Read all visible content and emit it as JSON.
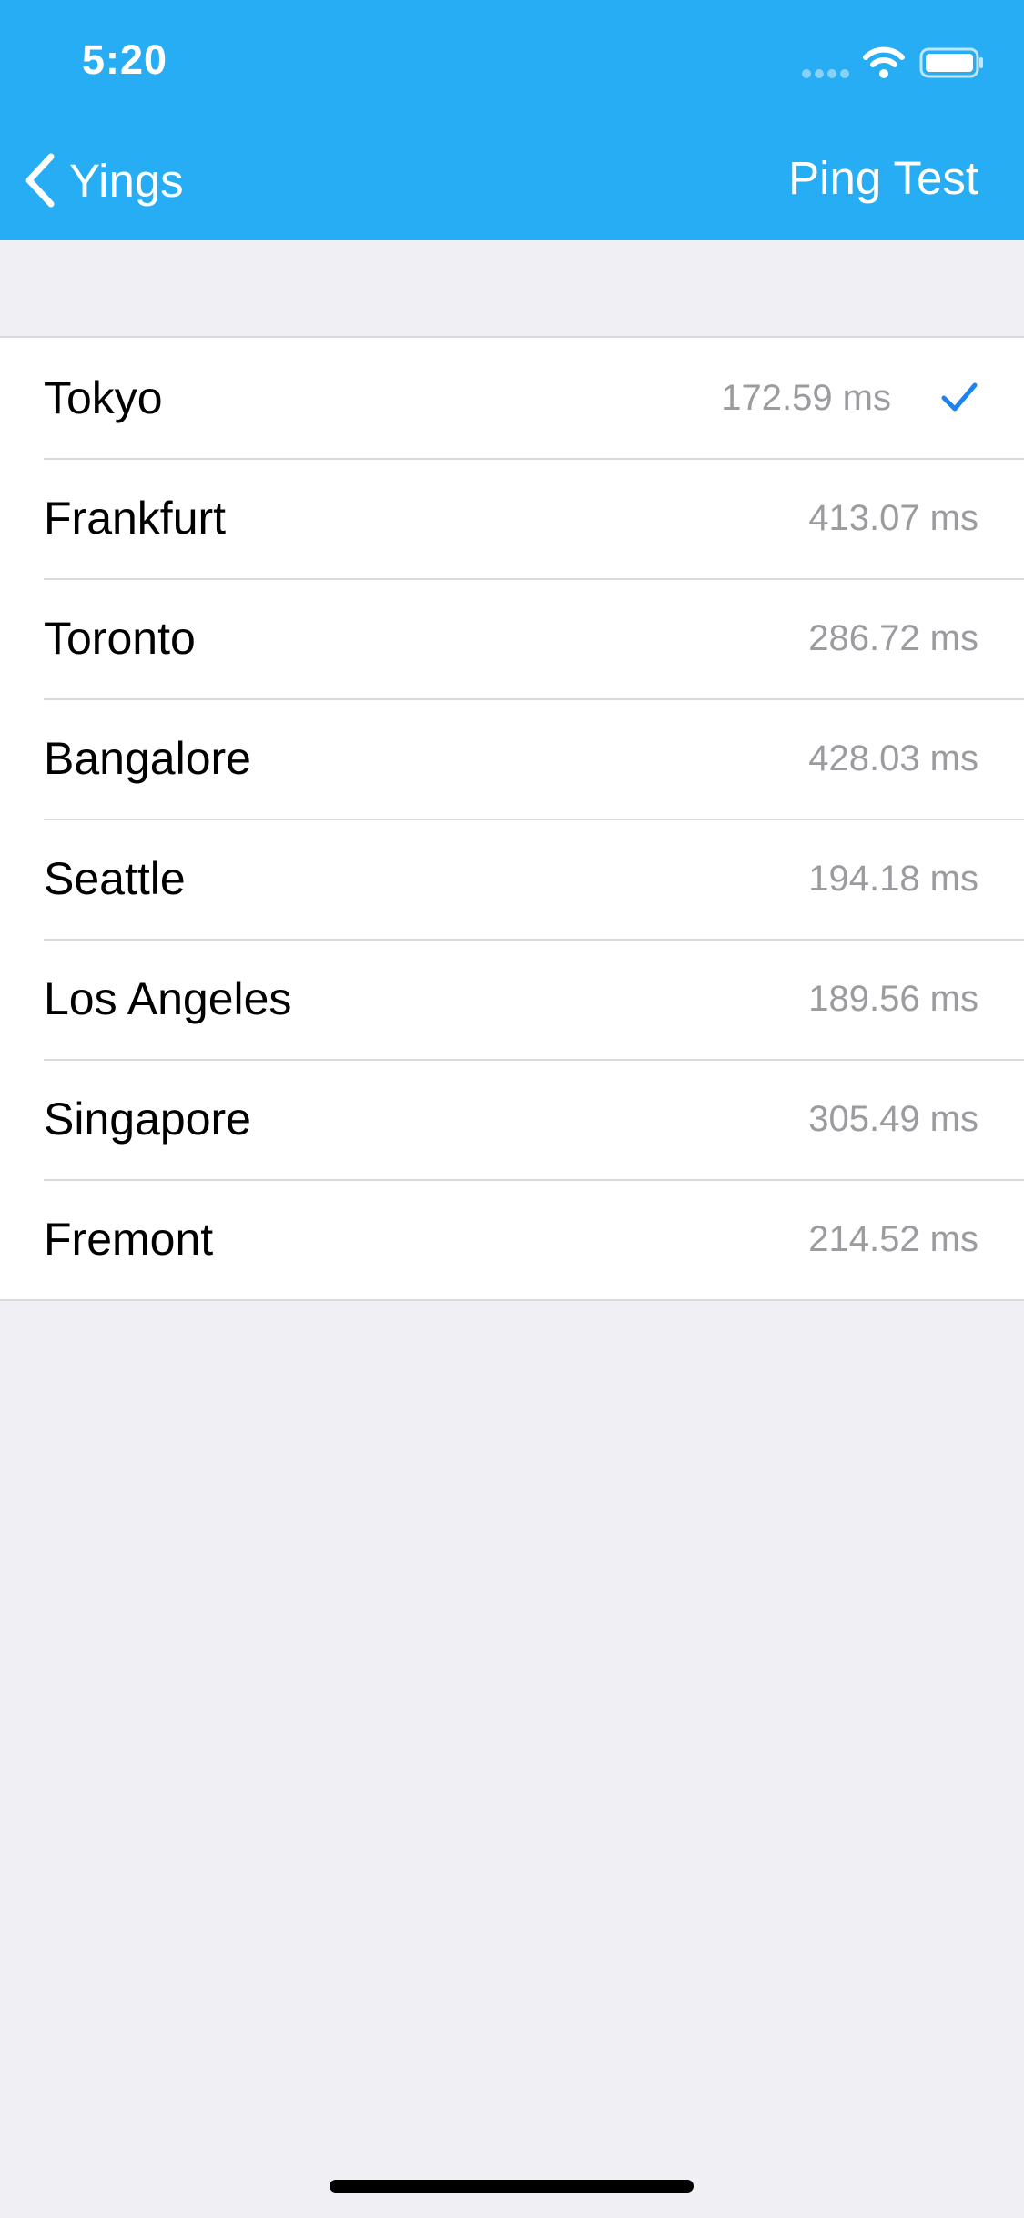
{
  "status_bar": {
    "time": "5:20"
  },
  "nav": {
    "back_label": "Yings",
    "right_label": "Ping Test"
  },
  "colors": {
    "header": "#26ADF4",
    "check": "#1A85F2",
    "latency_text": "#9B9BA0",
    "background": "#EFEFF4"
  },
  "servers": [
    {
      "name": "Tokyo",
      "latency": "172.59 ms",
      "selected": true
    },
    {
      "name": "Frankfurt",
      "latency": "413.07 ms",
      "selected": false
    },
    {
      "name": "Toronto",
      "latency": "286.72 ms",
      "selected": false
    },
    {
      "name": "Bangalore",
      "latency": "428.03 ms",
      "selected": false
    },
    {
      "name": "Seattle",
      "latency": "194.18 ms",
      "selected": false
    },
    {
      "name": "Los Angeles",
      "latency": "189.56 ms",
      "selected": false
    },
    {
      "name": "Singapore",
      "latency": "305.49 ms",
      "selected": false
    },
    {
      "name": "Fremont",
      "latency": "214.52 ms",
      "selected": false
    }
  ]
}
